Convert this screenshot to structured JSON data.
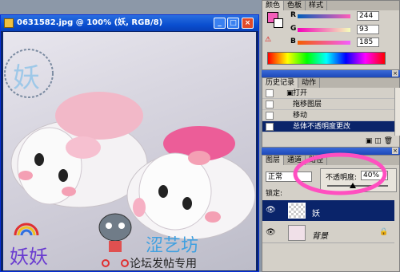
{
  "document": {
    "title": "0631582.jpg @ 100% (妖, RGB/8)",
    "min": "_",
    "max": "□",
    "close": "×",
    "watermark": "妖",
    "text_yaoyao": "妖妖",
    "text_sige": "涩艺坊",
    "text_forum": "论坛发帖专用"
  },
  "color_panel": {
    "tabs": [
      "颜色",
      "色板",
      "样式"
    ],
    "r_label": "R",
    "r_value": "244",
    "g_label": "G",
    "g_value": "93",
    "b_label": "B",
    "b_value": "185",
    "foreground_color": "#f45db9"
  },
  "history_panel": {
    "tabs": [
      "历史记录",
      "动作"
    ],
    "items": [
      "打开",
      "拖移图层",
      "移动",
      "总体不透明度更改"
    ]
  },
  "layers_panel": {
    "tabs": [
      "图层",
      "通道",
      "路径"
    ],
    "blend_mode": "正常",
    "opacity_label": "不透明度:",
    "opacity_value": "40%",
    "lock_label": "锁定:",
    "layers": [
      {
        "name": "妖"
      },
      {
        "name": "背景"
      }
    ]
  }
}
